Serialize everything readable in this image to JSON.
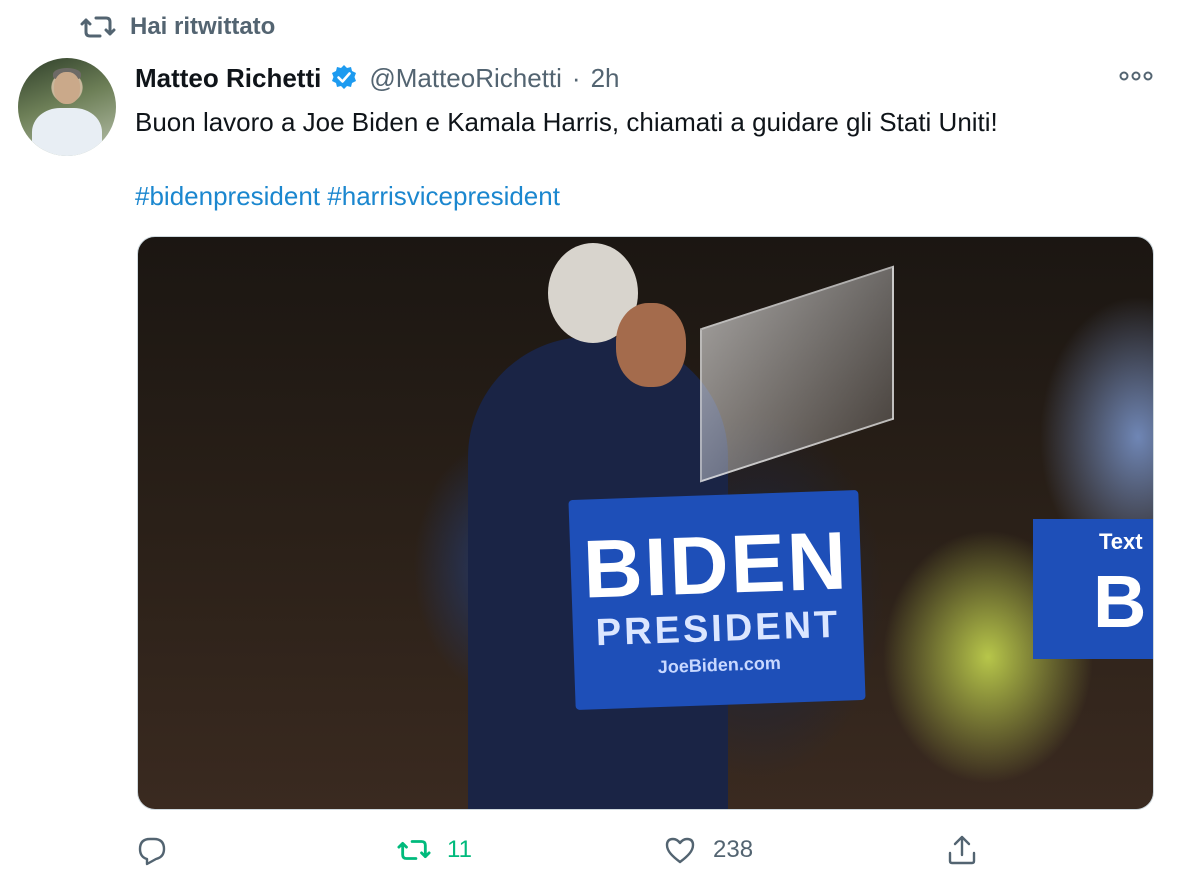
{
  "retweet_notice": {
    "label": "Hai ritwittato"
  },
  "tweet": {
    "author_name": "Matteo Richetti",
    "handle": "@MatteoRichetti",
    "separator": "·",
    "time": "2h",
    "text": "Buon lavoro a Joe Biden e Kamala Harris, chiamati a guidare gli Stati Uniti!",
    "hashtags": [
      "#bidenpresident",
      "#harrisvicepresident"
    ]
  },
  "media": {
    "sign_main_big": "BIDEN",
    "sign_main_small": "PRESIDENT",
    "sign_main_tiny": "JoeBiden.com",
    "sign_right_top": "Text",
    "sign_right_big": "B"
  },
  "actions": {
    "retweet_count": "11",
    "like_count": "238"
  },
  "colors": {
    "accent": "#1d9bf0",
    "retweet_green": "#00ba7c",
    "muted": "#536471",
    "verified_blue": "#1d9bf0"
  },
  "icons": {
    "retweet": "retweet-icon",
    "verified": "verified-badge-icon",
    "more": "more-icon",
    "reply": "reply-icon",
    "like": "heart-icon",
    "share": "share-icon"
  }
}
